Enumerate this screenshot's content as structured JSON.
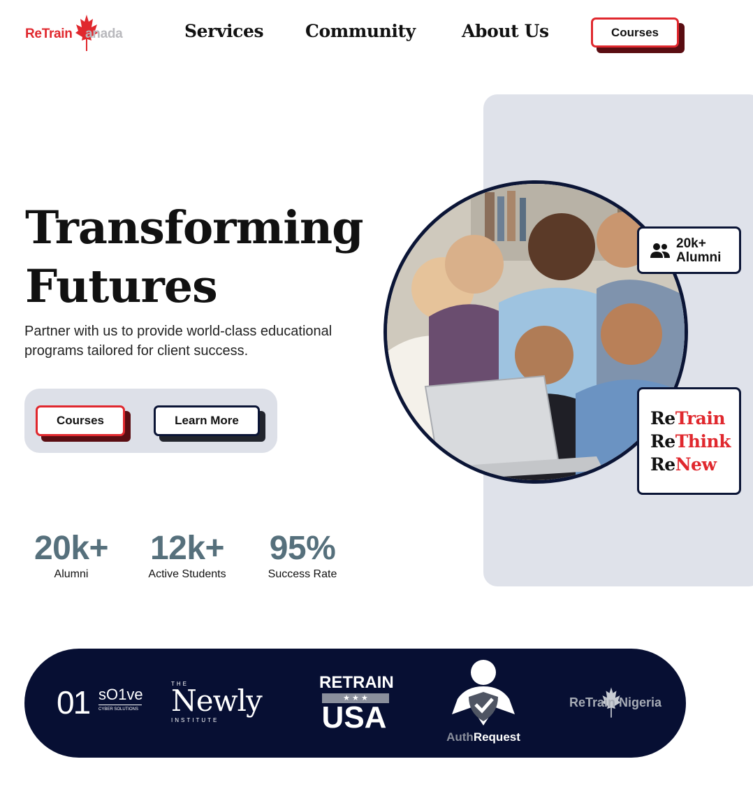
{
  "header": {
    "logo": {
      "part1": "ReTrain",
      "part2": "anada",
      "icon": "maple-leaf-icon"
    },
    "nav": [
      "Services",
      "Community",
      "About Us"
    ],
    "cta_label": "Courses"
  },
  "hero": {
    "title_line1": "Transforming",
    "title_line2": "Futures",
    "subtitle_line1": "Partner with us to provide world-class educational",
    "subtitle_line2": "programs tailored for client success.",
    "primary_label": "Courses",
    "secondary_label": "Learn More"
  },
  "stats": [
    {
      "value": "20k+",
      "label": "Alumni"
    },
    {
      "value": "12k+",
      "label": "Active Students"
    },
    {
      "value": "95%",
      "label": "Success Rate"
    }
  ],
  "cards": {
    "alumni": {
      "line1": "20k+",
      "line2": "Alumni",
      "icon": "users-icon"
    },
    "motto": [
      {
        "prefix": "Re",
        "word": "Train"
      },
      {
        "prefix": "Re",
        "word": "Think"
      },
      {
        "prefix": "Re",
        "word": "New"
      }
    ]
  },
  "partners": {
    "solve": {
      "big": "01",
      "name": "sO1ve",
      "tag": "CYBER SOLUTIONS"
    },
    "newly": {
      "top": "THE",
      "name": "Newly",
      "bottom": "INSTITUTE"
    },
    "retrain_usa": {
      "top": "RETRAIN",
      "stars": "★ ★ ★",
      "name": "USA"
    },
    "authrequest": {
      "part1": "Auth",
      "part2": "Request"
    },
    "retrain_nigeria": {
      "name": "ReTrain Nigeria"
    }
  },
  "colors": {
    "accent": "#e0282e",
    "navy": "#0b1536",
    "panel": "#dfe2ea",
    "stat": "#56707c"
  }
}
